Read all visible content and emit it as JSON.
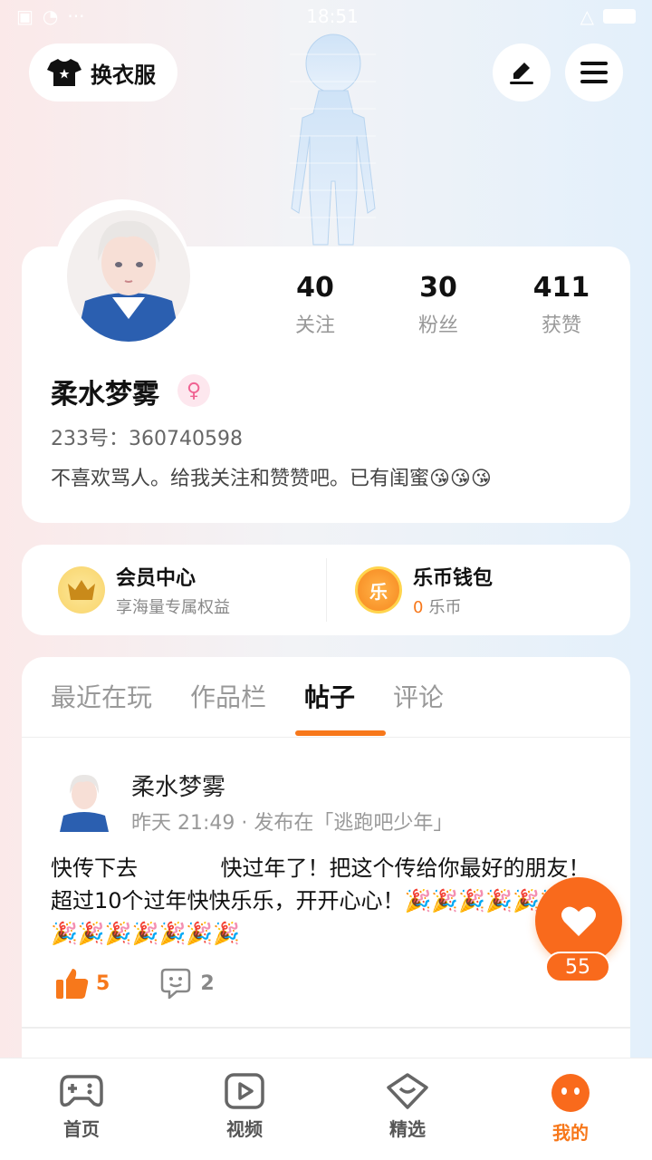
{
  "status_bar": {
    "time": "18:51"
  },
  "header": {
    "costume_label": "换衣服",
    "edit_icon": "pencil-icon",
    "menu_icon": "hamburger-icon"
  },
  "profile": {
    "name": "柔水梦雾",
    "gender_symbol": "♀",
    "uid": "233号：360740598",
    "bio": "不喜欢骂人。给我关注和赞赞吧。已有闺蜜😘😘😘",
    "stats": [
      {
        "value": "40",
        "label": "关注"
      },
      {
        "value": "30",
        "label": "粉丝"
      },
      {
        "value": "411",
        "label": "获赞"
      }
    ]
  },
  "quick": {
    "vip": {
      "title": "会员中心",
      "subtitle": "享海量专属权益"
    },
    "wallet": {
      "title": "乐币钱包",
      "coin_glyph": "乐",
      "amount": "0",
      "unit": "乐币"
    }
  },
  "tabs": [
    {
      "label": "最近在玩"
    },
    {
      "label": "作品栏"
    },
    {
      "label": "帖子"
    },
    {
      "label": "评论"
    }
  ],
  "post": {
    "author": "柔水梦雾",
    "meta": "昨天 21:49 · 发布在「逃跑吧少年」",
    "text": "快传下去            快过年了！把这个传给你最好的朋友！超过10个过年快快乐乐，开开心心！🎉🎉🎉🎉🎉🎉🎉🎉🎉🎉🎉🎉🎉🎉",
    "likes": "5",
    "comments": "2"
  },
  "fab": {
    "count": "55"
  },
  "nav": [
    {
      "label": "首页",
      "icon": "gamepad-icon"
    },
    {
      "label": "视频",
      "icon": "play-icon"
    },
    {
      "label": "精选",
      "icon": "heart-badge-icon"
    },
    {
      "label": "我的",
      "icon": "face-icon"
    }
  ],
  "colors": {
    "accent": "#f7781b",
    "fab": "#f96a1c"
  }
}
